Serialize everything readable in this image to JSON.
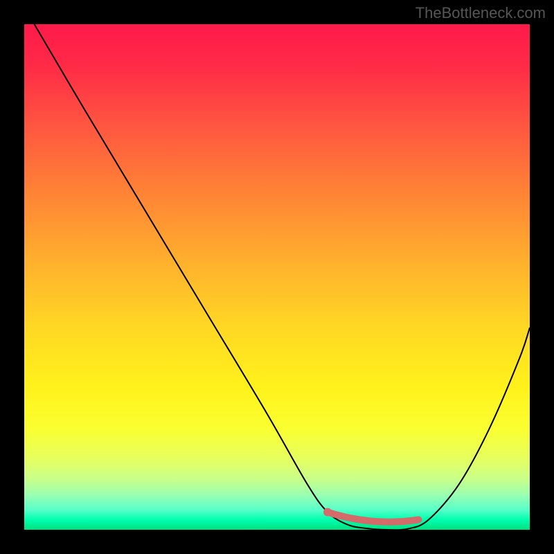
{
  "watermark": "TheBottleneck.com",
  "chart_data": {
    "type": "line",
    "title": "",
    "xlabel": "",
    "ylabel": "",
    "xlim": [
      0,
      100
    ],
    "ylim": [
      0,
      100
    ],
    "grid": false,
    "legend": false,
    "series": [
      {
        "name": "bottleneck-curve",
        "x": [
          2,
          12,
          24,
          36,
          48,
          56,
          60,
          64,
          68,
          72,
          76,
          80,
          86,
          92,
          98,
          100
        ],
        "values": [
          100,
          83,
          63,
          43,
          23,
          9,
          3.5,
          1,
          0.25,
          0,
          0.2,
          2,
          9,
          20,
          34,
          40
        ],
        "color": "#000000"
      }
    ],
    "highlight": {
      "name": "sweet-spot",
      "range_x": [
        60,
        78
      ],
      "range_values": [
        3.5,
        2
      ],
      "dot_x": 60,
      "dot_value": 3.5,
      "color": "#d46a6a"
    },
    "background_gradient": {
      "top": "#ff1a4a",
      "mid": "#fff21b",
      "bottom": "#00e07f"
    }
  }
}
